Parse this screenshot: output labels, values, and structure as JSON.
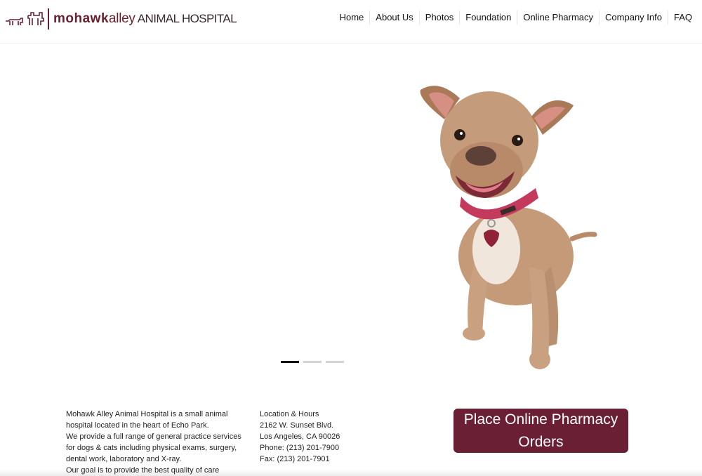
{
  "header": {
    "logo": {
      "name_bold": "mohawk",
      "name_light": "alley",
      "name_caps": " ANIMAL HOSPITAL",
      "color": "#6b1f2e"
    },
    "nav": [
      {
        "label": "Home"
      },
      {
        "label": "About Us"
      },
      {
        "label": "Photos"
      },
      {
        "label": "Foundation"
      },
      {
        "label": "Online Pharmacy"
      },
      {
        "label": "Company Info"
      },
      {
        "label": "FAQ"
      }
    ]
  },
  "hero": {
    "image_icon": "dog-photo",
    "slides_total": 3,
    "active_slide": 1
  },
  "about": {
    "lines": [
      "Mohawk Alley Animal Hospital is a small animal hospital located in the heart of Echo Park.",
      "We provide a full range of general practice services for dogs & cats including physical exams, surgery, dental work, laboratory and X-ray.",
      "Our goal is to provide the best quality of care"
    ]
  },
  "contact": {
    "heading": "Location & Hours",
    "address1": "2162 W. Sunset Blvd.",
    "address2": "Los Angeles, CA 90026",
    "phone": "Phone: (213) 201-7900",
    "fax": "Fax: (213) 201-7901"
  },
  "pharmacy_button": {
    "line1": "Place Online Pharmacy",
    "line2": "Orders",
    "color": "#6b1f35"
  }
}
